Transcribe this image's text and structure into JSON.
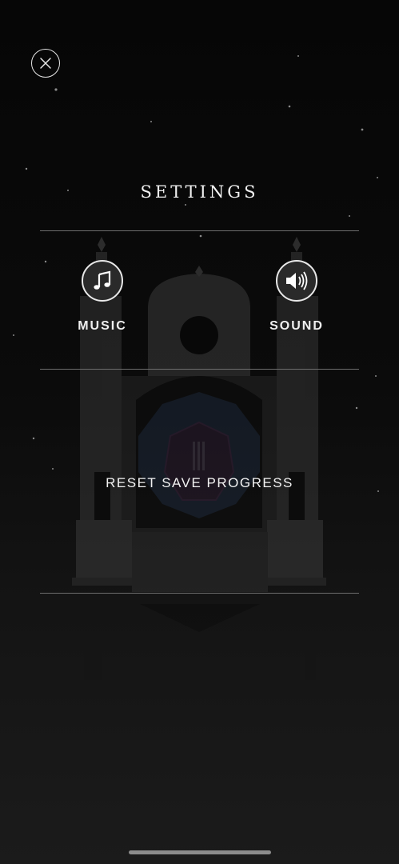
{
  "settings": {
    "title": "SETTINGS",
    "music_label": "MUSIC",
    "sound_label": "SOUND",
    "reset_label": "RESET SAVE PROGRESS"
  },
  "icons": {
    "close": "close-icon",
    "music": "music-note-icon",
    "sound": "speaker-volume-icon"
  },
  "colors": {
    "background": "#060606",
    "text": "#f2f2f2",
    "divider": "#6e6e6e",
    "monument": "#3a3a3a"
  }
}
